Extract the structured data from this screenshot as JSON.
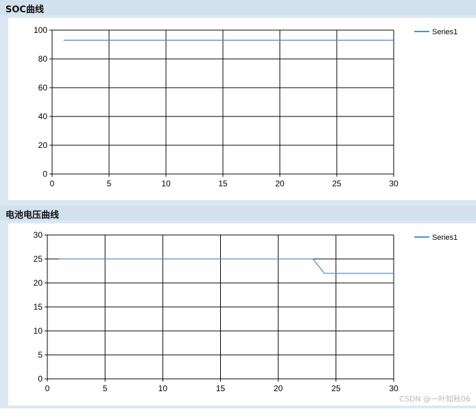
{
  "panels": [
    {
      "title": "SOC曲线"
    },
    {
      "title": "电池电压曲线"
    }
  ],
  "chart_data": [
    {
      "type": "line",
      "title": "SOC曲线",
      "xlabel": "",
      "ylabel": "",
      "xlim": [
        0,
        30
      ],
      "ylim": [
        0,
        100
      ],
      "xticks": [
        0,
        5,
        10,
        15,
        20,
        25,
        30
      ],
      "yticks": [
        0,
        20,
        40,
        60,
        80,
        100
      ],
      "grid": true,
      "legend": "top-right",
      "series": [
        {
          "name": "Series1",
          "color": "#4a90d9",
          "x": [
            1,
            30
          ],
          "y": [
            93,
            93
          ]
        }
      ]
    },
    {
      "type": "line",
      "title": "电池电压曲线",
      "xlabel": "",
      "ylabel": "",
      "xlim": [
        0,
        30
      ],
      "ylim": [
        0,
        30
      ],
      "xticks": [
        0,
        5,
        10,
        15,
        20,
        25,
        30
      ],
      "yticks": [
        0,
        5,
        10,
        15,
        20,
        25,
        30
      ],
      "grid": true,
      "legend": "top-right",
      "series": [
        {
          "name": "Series1",
          "color": "#4a90d9",
          "x": [
            1,
            23,
            24,
            25,
            30
          ],
          "y": [
            25,
            25,
            22,
            22,
            22
          ]
        }
      ]
    }
  ],
  "watermark": "CSDN @一叶知秋06"
}
